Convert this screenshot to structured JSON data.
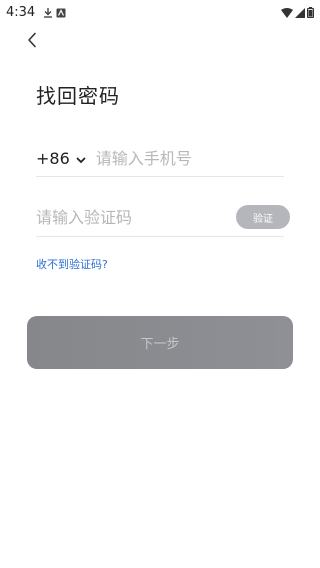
{
  "status_bar": {
    "time": "4:34",
    "left_icons": [
      "download-icon",
      "notification-icon"
    ],
    "right_icons": [
      "wifi-icon",
      "signal-icon",
      "battery-icon"
    ]
  },
  "header": {
    "back_icon": "chevron-left-icon",
    "title": "找回密码"
  },
  "form": {
    "country_code": "+86",
    "country_dropdown_icon": "chevron-down-icon",
    "phone_placeholder": "请输入手机号",
    "code_placeholder": "请输入验证码",
    "send_code_label": "验证"
  },
  "links": {
    "no_code": "收不到验证码?"
  },
  "actions": {
    "next_label": "下一步"
  },
  "colors": {
    "link": "#2f6fd6",
    "primary_button_disabled": "#8a8c90",
    "code_button_disabled": "#b4b6bb",
    "divider": "#e6e6e6"
  }
}
